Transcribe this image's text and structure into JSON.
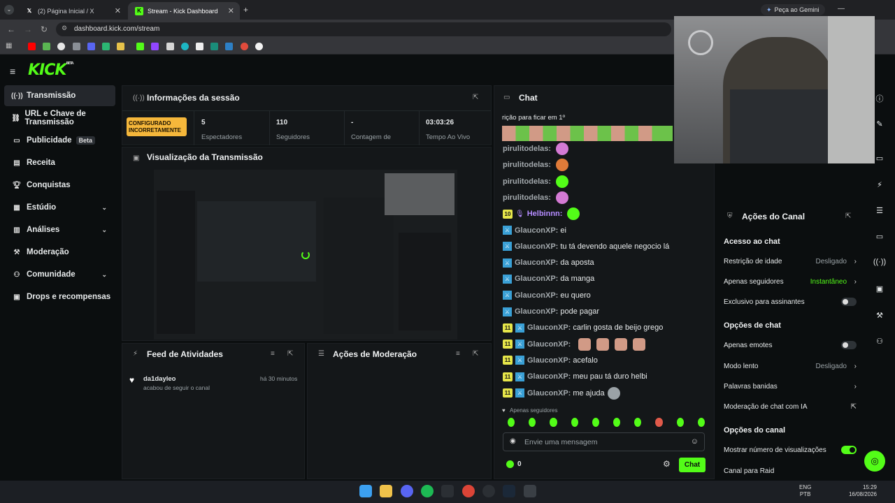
{
  "browser": {
    "tabs": [
      {
        "label": "(2) Página Inicial / X"
      },
      {
        "label": "Stream - Kick Dashboard"
      }
    ],
    "url": "dashboard.kick.com/stream",
    "gemini_label": "Peça ao Gemini"
  },
  "app": {
    "logo": "KICK",
    "logo_sup": "BETA"
  },
  "sidebar": {
    "items": [
      {
        "label": "Transmissão",
        "icon": "broadcast-icon"
      },
      {
        "label": "URL e Chave de Transmissão",
        "icon": "link-icon"
      },
      {
        "label": "Publicidade",
        "icon": "ads-icon",
        "badge": "Beta"
      },
      {
        "label": "Receita",
        "icon": "revenue-icon"
      },
      {
        "label": "Conquistas",
        "icon": "trophy-icon"
      },
      {
        "label": "Estúdio",
        "icon": "studio-icon"
      },
      {
        "label": "Análises",
        "icon": "analytics-icon"
      },
      {
        "label": "Moderação",
        "icon": "hammer-icon"
      },
      {
        "label": "Comunidade",
        "icon": "community-icon"
      },
      {
        "label": "Drops e recompensas",
        "icon": "drops-icon"
      }
    ]
  },
  "session": {
    "title": "Informações da sessão",
    "warning": "CONFIGURADO INCORRETAMENTE",
    "stats": [
      {
        "value": "5",
        "label": "Espectadores"
      },
      {
        "value": "110",
        "label": "Seguidores"
      },
      {
        "value": "-",
        "label": "Contagem de"
      },
      {
        "value": "03:03:26",
        "label": "Tempo Ao Vivo"
      }
    ]
  },
  "preview": {
    "title": "Visualização da Transmissão"
  },
  "feed": {
    "title": "Feed de Atividades",
    "items": [
      {
        "user": "da1dayleo",
        "text": "acabou de seguir o canal",
        "time": "há 30 minutos"
      }
    ]
  },
  "modactions": {
    "title": "Ações de Moderação"
  },
  "chat": {
    "title": "Chat",
    "pinned": "rição para ficar em 1º",
    "messages": [
      {
        "user": "pirulitodelas:",
        "text": "",
        "sub": "",
        "verified": false
      },
      {
        "user": "pirulitodelas:",
        "text": "",
        "sub": "",
        "verified": false
      },
      {
        "user": "pirulitodelas:",
        "text": "",
        "sub": "",
        "verified": false
      },
      {
        "user": "pirulitodelas:",
        "text": "",
        "sub": "",
        "verified": false
      },
      {
        "user": "Helbinnn:",
        "text": "",
        "sub": "10",
        "verified": false
      },
      {
        "user": "GlauconXP:",
        "text": "ei",
        "sub": "",
        "verified": true
      },
      {
        "user": "GlauconXP:",
        "text": "tu tá devendo aquele negocio lá",
        "sub": "",
        "verified": true
      },
      {
        "user": "GlauconXP:",
        "text": "da aposta",
        "sub": "",
        "verified": true
      },
      {
        "user": "GlauconXP:",
        "text": "da manga",
        "sub": "",
        "verified": true
      },
      {
        "user": "GlauconXP:",
        "text": "eu quero",
        "sub": "",
        "verified": true
      },
      {
        "user": "GlauconXP:",
        "text": "pode pagar",
        "sub": "",
        "verified": true
      },
      {
        "user": "GlauconXP:",
        "text": "carlin gosta de beijo grego",
        "sub": "11",
        "verified": true
      },
      {
        "user": "GlauconXP:",
        "text": "",
        "sub": "11",
        "verified": true
      },
      {
        "user": "GlauconXP:",
        "text": "acefalo",
        "sub": "11",
        "verified": true
      },
      {
        "user": "GlauconXP:",
        "text": "meu pau tá duro helbi",
        "sub": "11",
        "verified": true
      },
      {
        "user": "GlauconXP:",
        "text": "me ajuda",
        "sub": "11",
        "verified": true
      }
    ],
    "followers_only": "Apenas seguidores",
    "placeholder": "Envie uma mensagem",
    "points": "0",
    "send": "Chat"
  },
  "channel_actions": {
    "title": "Ações do Canal",
    "sections": [
      {
        "heading": "Acesso ao chat",
        "rows": [
          {
            "label": "Restrição de idade",
            "value": "Desligado"
          },
          {
            "label": "Apenas seguidores",
            "value": "Instantâneo"
          },
          {
            "label": "Exclusivo para assinantes",
            "toggle": false
          }
        ]
      },
      {
        "heading": "Opções de chat",
        "rows": [
          {
            "label": "Apenas emotes",
            "toggle": false
          },
          {
            "label": "Modo lento",
            "value": "Desligado"
          },
          {
            "label": "Palavras banidas"
          },
          {
            "label": "Moderação de chat com IA"
          }
        ]
      },
      {
        "heading": "Opções do canal",
        "rows": [
          {
            "label": "Mostrar número de visualizações",
            "toggle": true
          },
          {
            "label": "Canal para Raid"
          }
        ]
      }
    ]
  },
  "taskbar": {
    "lang": "ENG",
    "lang2": "PTB",
    "time": "15:29",
    "date": "16/08/2026"
  },
  "colors": {
    "accent": "#53fc18",
    "warning": "#f5b73b",
    "badge": "#e6e64a"
  }
}
